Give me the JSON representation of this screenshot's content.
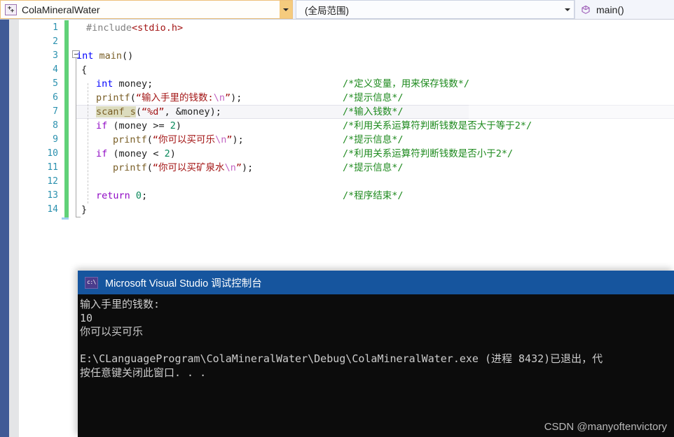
{
  "navbar": {
    "project_combo": {
      "icon": "cpp-project-icon",
      "value": "ColaMineralWater",
      "dropdown_icon": "chevron-down-icon"
    },
    "scope_combo": {
      "value": "(全局范围)",
      "dropdown_icon": "chevron-down-icon"
    },
    "member_combo": {
      "icon": "method-cube-icon",
      "value": "main()"
    }
  },
  "editor": {
    "line_numbers": [
      "1",
      "2",
      "3",
      "4",
      "5",
      "6",
      "7",
      "8",
      "9",
      "10",
      "11",
      "12",
      "13",
      "14"
    ],
    "lines": [
      {
        "n": 1,
        "code_html": "<span class='pre'>#include</span><span class='inc'>&lt;stdio.h&gt;</span>",
        "indent": 14,
        "comment": ""
      },
      {
        "n": 2,
        "code_html": "",
        "indent": 0,
        "comment": ""
      },
      {
        "n": 3,
        "code_html": "<span class='kw'>int</span> <span class='fn'>main</span><span class='id'>()</span>",
        "indent": 0,
        "comment": ""
      },
      {
        "n": 4,
        "code_html": "<span class='id'>{</span>",
        "indent": 7,
        "comment": ""
      },
      {
        "n": 5,
        "code_html": "<span class='kw'>int</span> <span class='id'>money</span><span class='id'>;</span>",
        "indent": 28,
        "comment": "/*定义变量，用来保存钱数*/"
      },
      {
        "n": 6,
        "code_html": "<span class='fn'>printf</span><span class='id'>(</span><span class='str'>“输入手里的钱数:</span><span class='esc'>\\n</span><span class='str'>”</span><span class='id'>);</span>",
        "indent": 28,
        "comment": "/*提示信息*/"
      },
      {
        "n": 7,
        "code_html": "<span class='fn ref'>scanf_s</span><span class='id'>(</span><span class='str'>“%d”</span><span class='id'>, &amp;</span><span class='id'>money</span><span class='id'>);</span>",
        "indent": 28,
        "comment": "/*输入钱数*/"
      },
      {
        "n": 8,
        "code_html": "<span class='kw2'>if</span> <span class='id'>(</span><span class='id'>money</span> <span class='id'>&gt;=</span> <span class='num'>2</span><span class='id'>)</span>",
        "indent": 28,
        "comment": "/*利用关系运算符判断钱数是否大于等于2*/"
      },
      {
        "n": 9,
        "code_html": "<span class='fn'>printf</span><span class='id'>(</span><span class='str'>“你可以买可乐</span><span class='esc'>\\n</span><span class='str'>”</span><span class='id'>);</span>",
        "indent": 52,
        "comment": "/*提示信息*/"
      },
      {
        "n": 10,
        "code_html": "<span class='kw2'>if</span> <span class='id'>(</span><span class='id'>money</span> <span class='id'>&lt;</span> <span class='num'>2</span><span class='id'>)</span>",
        "indent": 28,
        "comment": "/*利用关系运算符判断钱数是否小于2*/"
      },
      {
        "n": 11,
        "code_html": "<span class='fn'>printf</span><span class='id'>(</span><span class='str'>“你可以买矿泉水</span><span class='esc'>\\n</span><span class='str'>”</span><span class='id'>);</span>",
        "indent": 52,
        "comment": "/*提示信息*/"
      },
      {
        "n": 12,
        "code_html": "",
        "indent": 0,
        "comment": ""
      },
      {
        "n": 13,
        "code_html": "<span class='kw2'>return</span> <span class='num'>0</span><span class='id'>;</span>",
        "indent": 28,
        "comment": "/*程序结束*/"
      },
      {
        "n": 14,
        "code_html": "<span class='id'>}</span>",
        "indent": 7,
        "comment": ""
      }
    ],
    "highlighted_line": 7,
    "fold_icon": "collapse-minus-icon",
    "change_bar_color": "#60d178",
    "line_number_color": "#2b91af",
    "comment_color": "#1e8a1e"
  },
  "console": {
    "icon": "cmd-prompt-icon",
    "icon_text": "c:\\",
    "title": "Microsoft Visual Studio 调试控制台",
    "title_bar_color": "#16559e",
    "background_color": "#0c0c0c",
    "output_lines": [
      "输入手里的钱数:",
      "10",
      "你可以买可乐",
      "",
      "E:\\CLanguageProgram\\ColaMineralWater\\Debug\\ColaMineralWater.exe (进程 8432)已退出，代",
      "按任意键关闭此窗口. . ."
    ],
    "watermark": "CSDN @manyoftenvictory"
  }
}
